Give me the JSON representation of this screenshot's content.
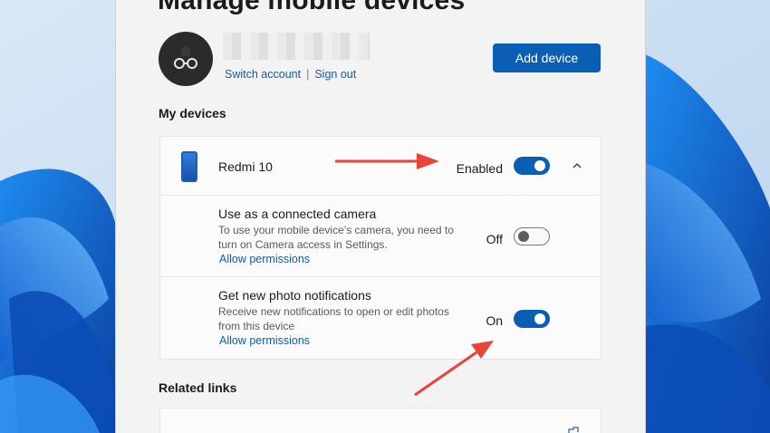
{
  "dialog": {
    "title": "Manage mobile devices",
    "add_device_label": "Add device"
  },
  "account": {
    "switch_label": "Switch account",
    "separator": "|",
    "sign_out_label": "Sign out"
  },
  "sections": {
    "my_devices": "My devices",
    "related_links": "Related links"
  },
  "device": {
    "name": "Redmi 10",
    "state_label": "Enabled",
    "enabled": true
  },
  "options": [
    {
      "title": "Use as a connected camera",
      "desc_line1": "To use your mobile device’s camera, you need to",
      "desc_line2": "turn on Camera access in Settings.",
      "link": "Allow permissions",
      "state_label": "Off",
      "on": false
    },
    {
      "title": "Get new photo notifications",
      "desc_line1": "Receive new notifications to open or edit photos",
      "desc_line2": "from this device",
      "link": "Allow permissions",
      "state_label": "On",
      "on": true
    }
  ],
  "colors": {
    "accent": "#0a5fb4",
    "link": "#0b5cad",
    "annotation_arrow": "#e8443a"
  },
  "icons": [
    "avatar-glasses-icon",
    "phone-icon",
    "chevron-up-icon",
    "arrow-annotation"
  ]
}
